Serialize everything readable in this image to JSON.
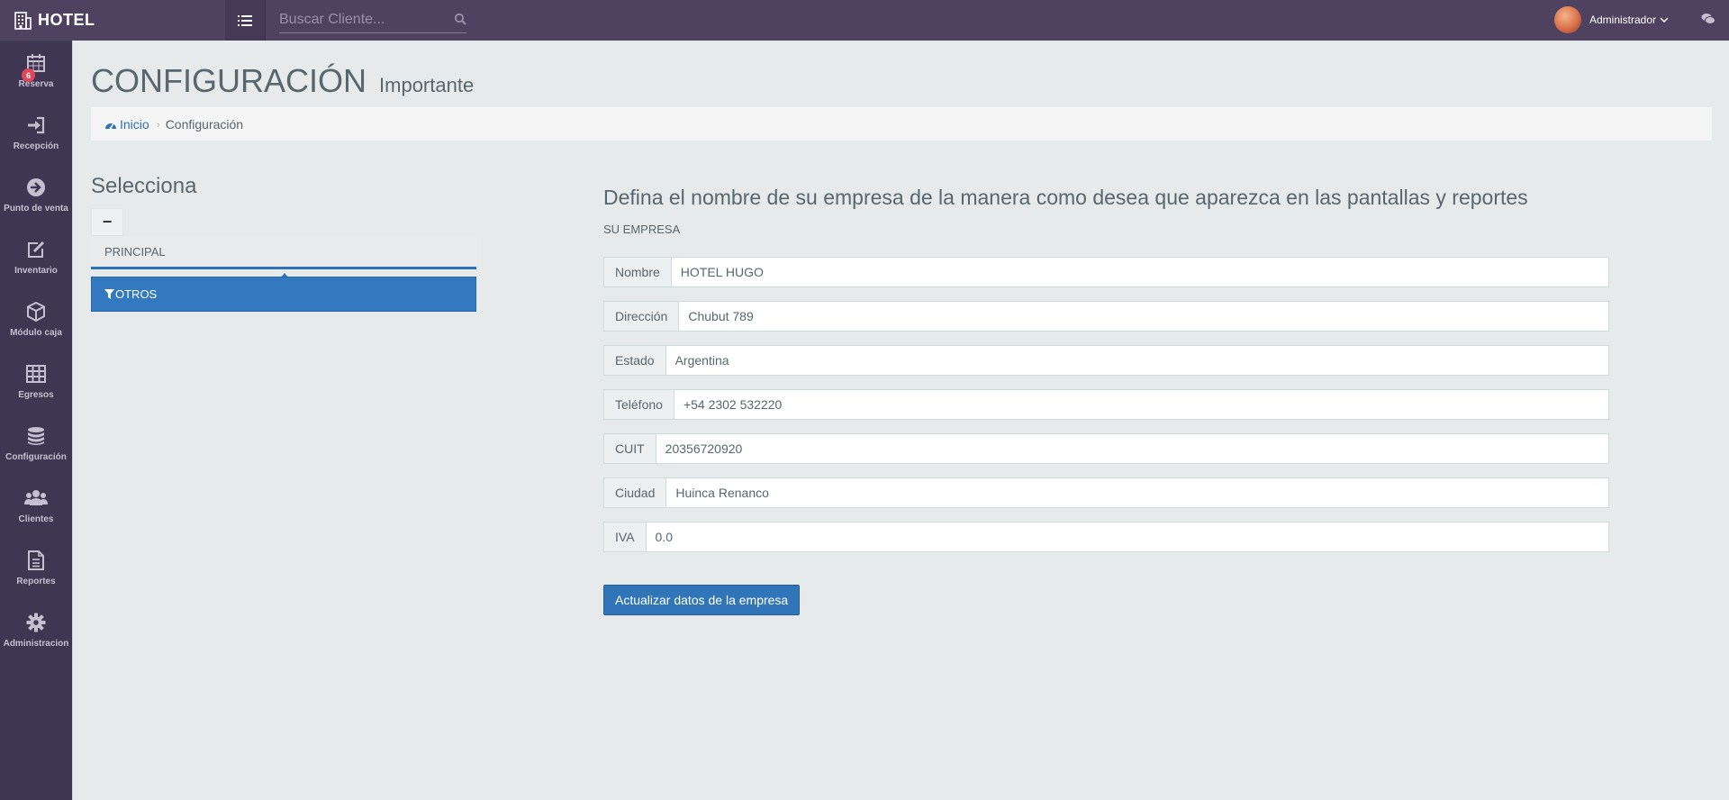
{
  "app": {
    "brand": "HOTEL"
  },
  "topbar": {
    "search_placeholder": "Buscar Cliente...",
    "user_name": "Administrador"
  },
  "sidebar": {
    "badge_count": "6",
    "items": [
      {
        "label": "Reserva",
        "icon": "calendar-icon"
      },
      {
        "label": "Recepción",
        "icon": "sign-in-icon"
      },
      {
        "label": "Punto de venta",
        "icon": "arrow-circle-icon"
      },
      {
        "label": "Inventario",
        "icon": "edit-icon"
      },
      {
        "label": "Módulo caja",
        "icon": "cube-icon"
      },
      {
        "label": "Egresos",
        "icon": "table-icon"
      },
      {
        "label": "Configuración",
        "icon": "database-icon"
      },
      {
        "label": "Clientes",
        "icon": "users-icon"
      },
      {
        "label": "Reportes",
        "icon": "file-text-icon"
      },
      {
        "label": "Administracion",
        "icon": "gear-icon"
      }
    ]
  },
  "page": {
    "title": "CONFIGURACIÓN",
    "subtitle": "Importante"
  },
  "breadcrumb": {
    "home": "Inicio",
    "current": "Configuración"
  },
  "selector": {
    "title": "Selecciona",
    "collapse_label": "−",
    "tabs": [
      "PRINCIPAL",
      "OTROS"
    ]
  },
  "form": {
    "title": "Defina el nombre de su empresa de la manera como desea que aparezca en las pantallas y reportes",
    "subtitle": "SU EMPRESA",
    "fields": [
      {
        "label": "Nombre",
        "value": "HOTEL HUGO"
      },
      {
        "label": "Dirección",
        "value": "Chubut 789"
      },
      {
        "label": "Estado",
        "value": "Argentina"
      },
      {
        "label": "Teléfono",
        "value": "+54 2302 532220"
      },
      {
        "label": "CUIT",
        "value": "20356720920"
      },
      {
        "label": "Ciudad",
        "value": "Huinca Renanco"
      },
      {
        "label": "IVA",
        "value": "0.0"
      }
    ],
    "submit_label": "Actualizar datos de la empresa"
  },
  "colors": {
    "topbar": "#4e4260",
    "sidebar": "#3f3651",
    "primary": "#2f75b7",
    "badge": "#e4455a"
  }
}
